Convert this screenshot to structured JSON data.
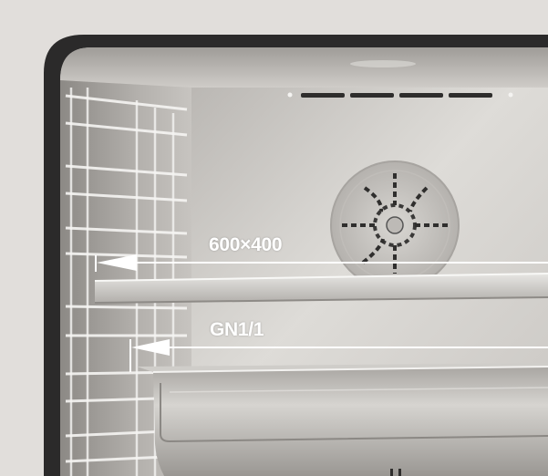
{
  "image": {
    "subject": "oven-interior",
    "colors": {
      "background": "#e1dedb",
      "oven_frame": "#2b2a2a",
      "steel_light": "#d7d5d1",
      "steel_dark": "#8f8c88",
      "annotation": "#ffffff"
    }
  },
  "annotations": {
    "tray_size_label": "600×400",
    "gastronorm_label": "GN1/1"
  }
}
